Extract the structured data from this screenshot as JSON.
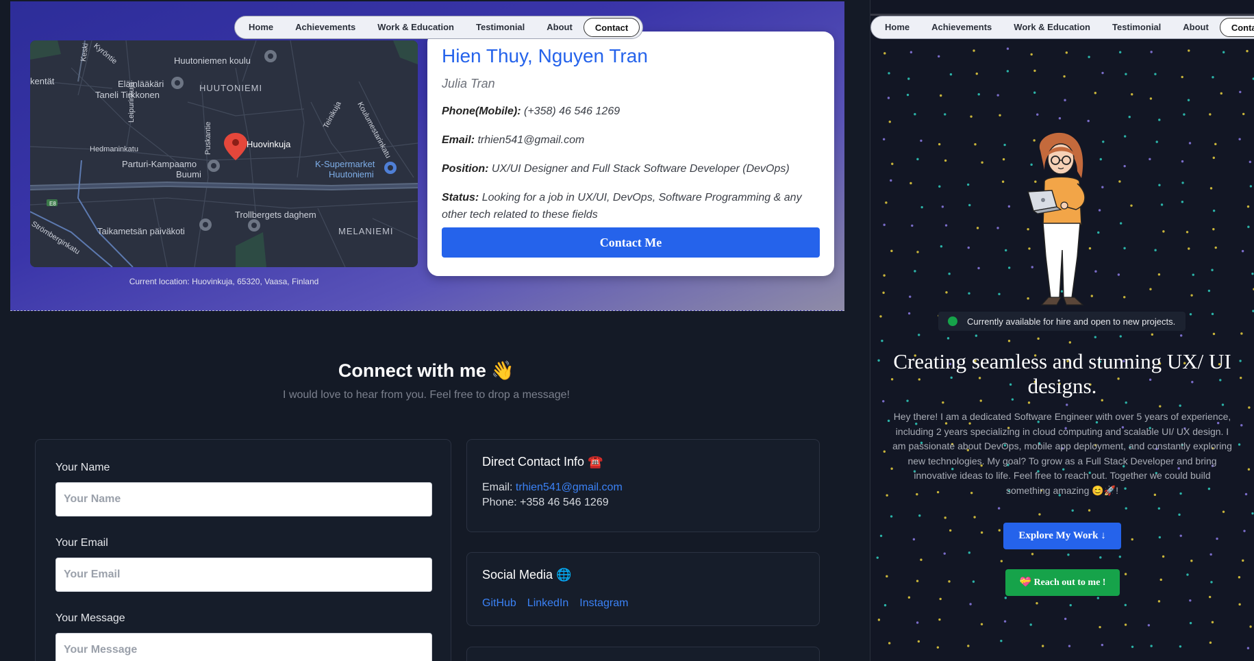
{
  "nav": {
    "items": [
      "Home",
      "Achievements",
      "Work & Education",
      "Testimonial",
      "About",
      "Contact"
    ],
    "active": "Contact"
  },
  "map": {
    "labels": {
      "koulu": "Huutoniemen koulu",
      "elain": "Eläinlääkäri",
      "taneli": "Taneli Tirkkonen",
      "huutoniemi": "HUUTONIEMI",
      "kentat": "kentät",
      "huovinkuja": "Huovinkuja",
      "hedman": "Hedmaninkatu",
      "parturi1": "Parturi-Kampaamo",
      "parturi2": "Buumi",
      "ksuper1": "K-Supermarket",
      "ksuper2": "Huutoniemi",
      "troll": "Trollbergets daghem",
      "taika": "Taikametsän päiväkoti",
      "melaniemi": "MELANIEMI",
      "strom": "Strömberginkatu",
      "leipurin": "Leipurinkuja",
      "puskantie": "Puskantie",
      "teinikuja": "Teinikuja",
      "koulumestarin": "Koulumestarinkatu",
      "keski": "Keski",
      "kyrontie": "Kyröntie",
      "e8": "E8"
    },
    "caption": "Current location: Huovinkuja, 65320, Vaasa, Finland"
  },
  "profile": {
    "name": "Hien Thuy, Nguyen Tran",
    "alias": "Julia Tran",
    "phone_label": "Phone(Mobile):",
    "phone_value": "(+358) 46 546 1269",
    "email_label": "Email:",
    "email_value": "trhien541@gmail.com",
    "position_label": "Position:",
    "position_value": "UX/UI Designer and Full Stack Software Developer (DevOps)",
    "status_label": "Status:",
    "status_value": "Looking for a job in UX/UI, DevOps, Software Programming & any other tech related to these fields",
    "button": "Contact Me"
  },
  "connect": {
    "title": "Connect with me 👋",
    "subtitle": "I would love to hear from you. Feel free to drop a message!"
  },
  "form": {
    "name_label": "Your Name",
    "name_placeholder": "Your Name",
    "email_label": "Your Email",
    "email_placeholder": "Your Email",
    "message_label": "Your Message",
    "message_placeholder": "Your Message"
  },
  "direct": {
    "title": "Direct Contact Info ☎️",
    "email_prefix": "Email: ",
    "email": "trhien541@gmail.com",
    "phone": "Phone: +358 46 546 1269"
  },
  "social": {
    "title": "Social Media 🌐",
    "links": [
      "GitHub",
      "LinkedIn",
      "Instagram"
    ]
  },
  "hero_right": {
    "badge": "Currently available for hire and open to new projects.",
    "headline": "Creating seamless and stunning UX/ UI designs.",
    "bio": "Hey there! I am a dedicated Software Engineer with over 5 years of experience, including 2 years specializing in cloud computing and scalable UI/ UX design. I am passionate about DevOps, mobile app deployment, and constantly exploring new technologies. My goal? To grow as a Full Stack Developer and bring innovative ideas to life. Feel free to reach out. Together we could build something amazing 😊🚀!",
    "explore": "Explore My Work",
    "reach": "💝 Reach out to me !"
  },
  "colors": {
    "accent": "#2563eb",
    "success": "#16a34a",
    "dark_bg": "#141a26"
  }
}
